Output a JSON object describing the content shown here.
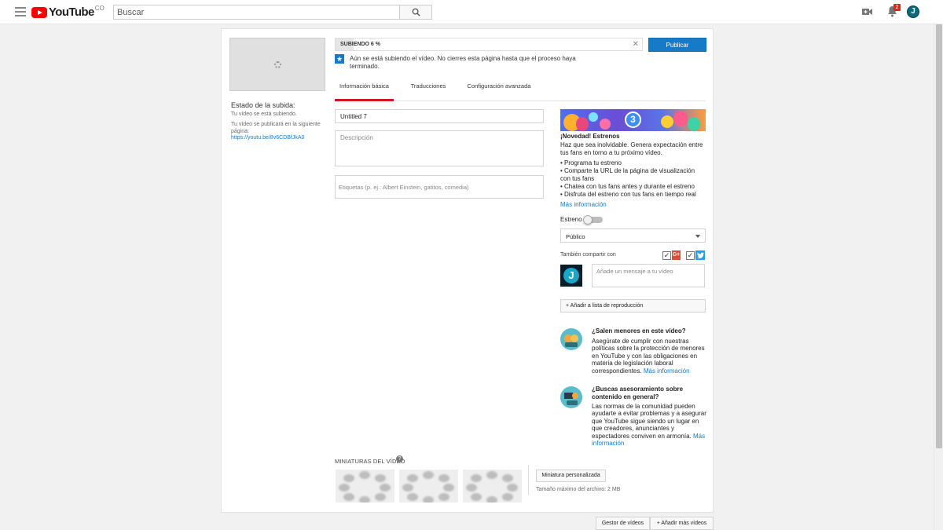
{
  "header": {
    "logo_text": "YouTube",
    "logo_country": "CO",
    "search_placeholder": "Buscar",
    "notification_count": "2",
    "avatar_letter": "J"
  },
  "upload": {
    "status_title": "Estado de la subida:",
    "status_line1": "Tu vídeo se está subiendo.",
    "status_line2": "Tu vídeo se publicará en la siguiente página:",
    "video_url": "https://youtu.be/8v6CDBfJkA0",
    "progress_label": "SUBIENDO 6 %",
    "progress_value": 0.06,
    "publish_label": "Publicar",
    "message": "Aún se está subiendo el vídeo. No cierres esta página hasta que el proceso haya terminado."
  },
  "tabs": [
    {
      "label": "Información básica",
      "active": true
    },
    {
      "label": "Traducciones",
      "active": false
    },
    {
      "label": "Configuración avanzada",
      "active": false
    }
  ],
  "form": {
    "title_value": "Untitled 7",
    "description_placeholder": "Descripción",
    "tags_placeholder": "Etiquetas (p. ej.: Albert Einstein, gatitos, comedia)"
  },
  "premiere": {
    "banner_number": "3",
    "title": "¡Novedad! Estrenos",
    "description": "Haz que sea inolvidable. Genera expectación entre tus fans en torno a tu próximo vídeo.",
    "bullets": [
      "• Programa tu estreno",
      "• Comparte la URL de la página de visualización con tus fans",
      "• Chatea con tus fans antes y durante el estreno",
      "• Disfruta del estreno con tus fans en tiempo real"
    ],
    "more_link": "Más información",
    "toggle_label": "Estreno",
    "toggle_on": false
  },
  "privacy": {
    "selected": "Público"
  },
  "share": {
    "label": "También compartir con",
    "gplus_checked": true,
    "twitter_checked": true,
    "gplus_text": "G+",
    "channel_letter": "J",
    "message_placeholder": "Añade un mensaje a tu vídeo",
    "playlist_label": "+ Añadir a lista de reproducción"
  },
  "kids": {
    "title": "¿Salen menores en este vídeo?",
    "text": "Asegúrate de cumplir con nuestras políticas sobre la protección de menores en YouTube y con las obligaciones en materia de legislación laboral correspondientes.",
    "more_link": "Más información"
  },
  "community": {
    "title": "¿Buscas asesoramiento sobre contenido en general?",
    "text": "Las normas de la comunidad pueden ayudarte a evitar problemas y a asegurar que YouTube sigue siendo un lugar en que creadores, anunciantes y espectadores conviven en armonía.",
    "more_link": "Más información"
  },
  "thumbnails": {
    "label": "MINIATURAS DEL VÍDEO",
    "custom_label": "Miniatura personalizada",
    "size_note": "Tamaño máximo del archivo: 2 MB"
  },
  "footer": {
    "video_manager": "Gestor de vídeos",
    "add_more": "+ Añadir más vídeos"
  },
  "colors": {
    "accent_blue": "#167ac6",
    "tab_active_red": "#cc181e",
    "youtube_red": "#ff0000"
  },
  "icons": [
    "menu-icon",
    "search-icon",
    "video-camera-icon",
    "bell-icon",
    "star-icon",
    "close-icon",
    "help-icon",
    "twitter-icon",
    "google-plus-icon"
  ]
}
